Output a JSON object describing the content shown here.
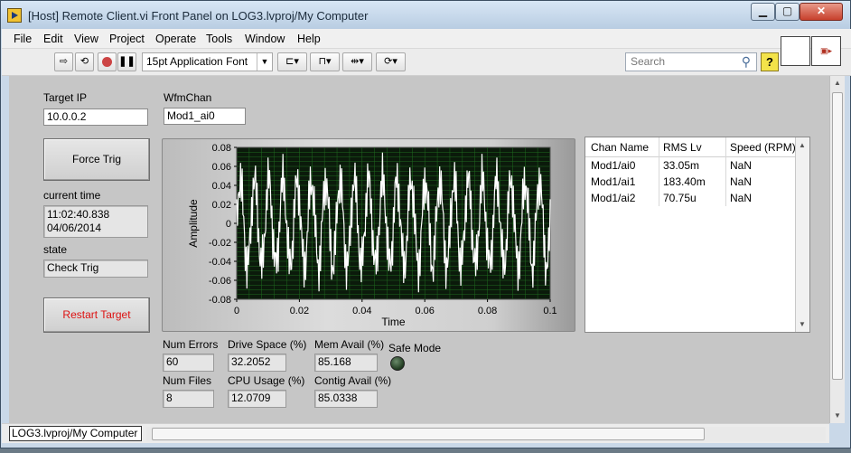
{
  "window": {
    "title": "[Host] Remote Client.vi Front Panel on LOG3.lvproj/My Computer",
    "min": "▁",
    "max": "▢",
    "close": "✕"
  },
  "menu": [
    "File",
    "Edit",
    "View",
    "Project",
    "Operate",
    "Tools",
    "Window",
    "Help"
  ],
  "toolbar": {
    "font": "15pt Application Font",
    "search_placeholder": "Search",
    "help": "?",
    "icons": [
      "run-arrow-icon",
      "run-continuous-icon",
      "abort-icon",
      "pause-icon",
      "align-icon",
      "distribute-icon",
      "resize-icon",
      "reorder-icon"
    ]
  },
  "panel": {
    "target_ip": {
      "label": "Target IP",
      "value": "10.0.0.2"
    },
    "wfm_chan": {
      "label": "WfmChan",
      "value": "Mod1_ai0"
    },
    "force_trig": "Force Trig",
    "current_time": {
      "label": "current time",
      "time": "11:02:40.838",
      "date": "04/06/2014"
    },
    "state": {
      "label": "state",
      "value": "Check Trig"
    },
    "restart": "Restart Target",
    "stats": [
      {
        "label": "Num Errors",
        "value": "60"
      },
      {
        "label": "Drive Space (%)",
        "value": "32.2052"
      },
      {
        "label": "Mem Avail (%)",
        "value": "85.168"
      },
      {
        "label": "Num Files",
        "value": "8"
      },
      {
        "label": "CPU Usage (%)",
        "value": "12.0709"
      },
      {
        "label": "Contig Avail (%)",
        "value": "85.0338"
      }
    ],
    "safe_mode": {
      "label": "Safe Mode",
      "on": false
    },
    "table": {
      "headers": [
        "Chan Name",
        "RMS Lv",
        "Speed (RPM)"
      ],
      "rows": [
        [
          "Mod1/ai0",
          "33.05m",
          "NaN"
        ],
        [
          "Mod1/ai1",
          "183.40m",
          "NaN"
        ],
        [
          "Mod1/ai2",
          "70.75u",
          "NaN"
        ]
      ]
    }
  },
  "statusbar": {
    "context": "LOG3.lvproj/My Computer"
  },
  "chart_data": {
    "type": "line",
    "xlabel": "Time",
    "ylabel": "Amplitude",
    "xlim": [
      0,
      0.1
    ],
    "ylim": [
      -0.08,
      0.08
    ],
    "xticks": [
      "0",
      "0.02",
      "0.04",
      "0.06",
      "0.08",
      "0.1"
    ],
    "yticks": [
      "0.08",
      "0.06",
      "0.04",
      "0.02",
      "0",
      "-0.02",
      "-0.04",
      "-0.06",
      "-0.08"
    ],
    "grid": true,
    "plot_bg": "#0b1a0b",
    "grid_color": "#1f6b1f",
    "trace_color": "#ffffff",
    "series": [
      {
        "x_start": 0,
        "x_end": 0.1,
        "points": 400,
        "components": [
          {
            "freq": 220,
            "amp": 0.045
          },
          {
            "freq": 1700,
            "amp": 0.022
          },
          {
            "freq": 470,
            "amp": 0.008
          }
        ]
      }
    ]
  }
}
